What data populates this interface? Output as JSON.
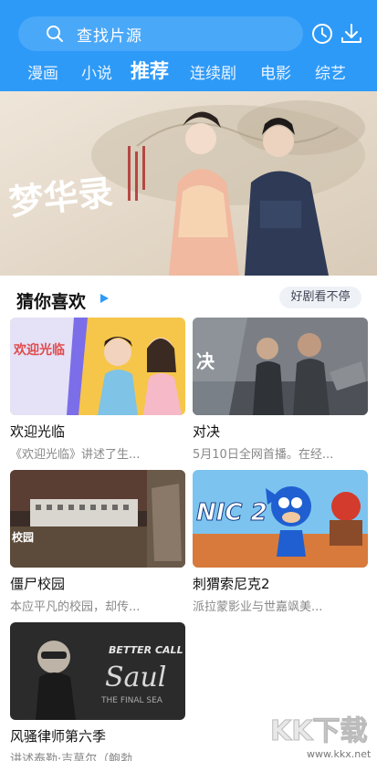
{
  "search": {
    "placeholder": "查找片源"
  },
  "tabs": [
    {
      "label": "漫画",
      "active": false
    },
    {
      "label": "小说",
      "active": false
    },
    {
      "label": "推荐",
      "active": true
    },
    {
      "label": "连续剧",
      "active": false
    },
    {
      "label": "电影",
      "active": false
    },
    {
      "label": "综艺",
      "active": false
    }
  ],
  "banner": {
    "title_art": "梦华录"
  },
  "section": {
    "title": "猜你喜欢",
    "tag": "好剧看不停"
  },
  "cards": [
    {
      "title": "欢迎光临",
      "desc": "《欢迎光临》讲述了生...",
      "poster_text": "欢迎光临"
    },
    {
      "title": "对决",
      "desc": "5月10日全网首播。在经...",
      "poster_text": "决"
    },
    {
      "title": "僵尸校园",
      "desc": "本应平凡的校园，却传...",
      "poster_text": "校园"
    },
    {
      "title": "刺猬索尼克2",
      "desc": "派拉蒙影业与世嘉飒美...",
      "poster_text": "NIC 2"
    },
    {
      "title": "风骚律师第六季",
      "desc": "讲述泰勒·吉莫尔（鲍勃...",
      "poster_text": "BETTER CALL Saul"
    }
  ],
  "watermark": {
    "text": "KK下载",
    "url": "www.kkx.net"
  },
  "colors": {
    "header_bg": "#2e9af8",
    "accent": "#2e9af8"
  }
}
